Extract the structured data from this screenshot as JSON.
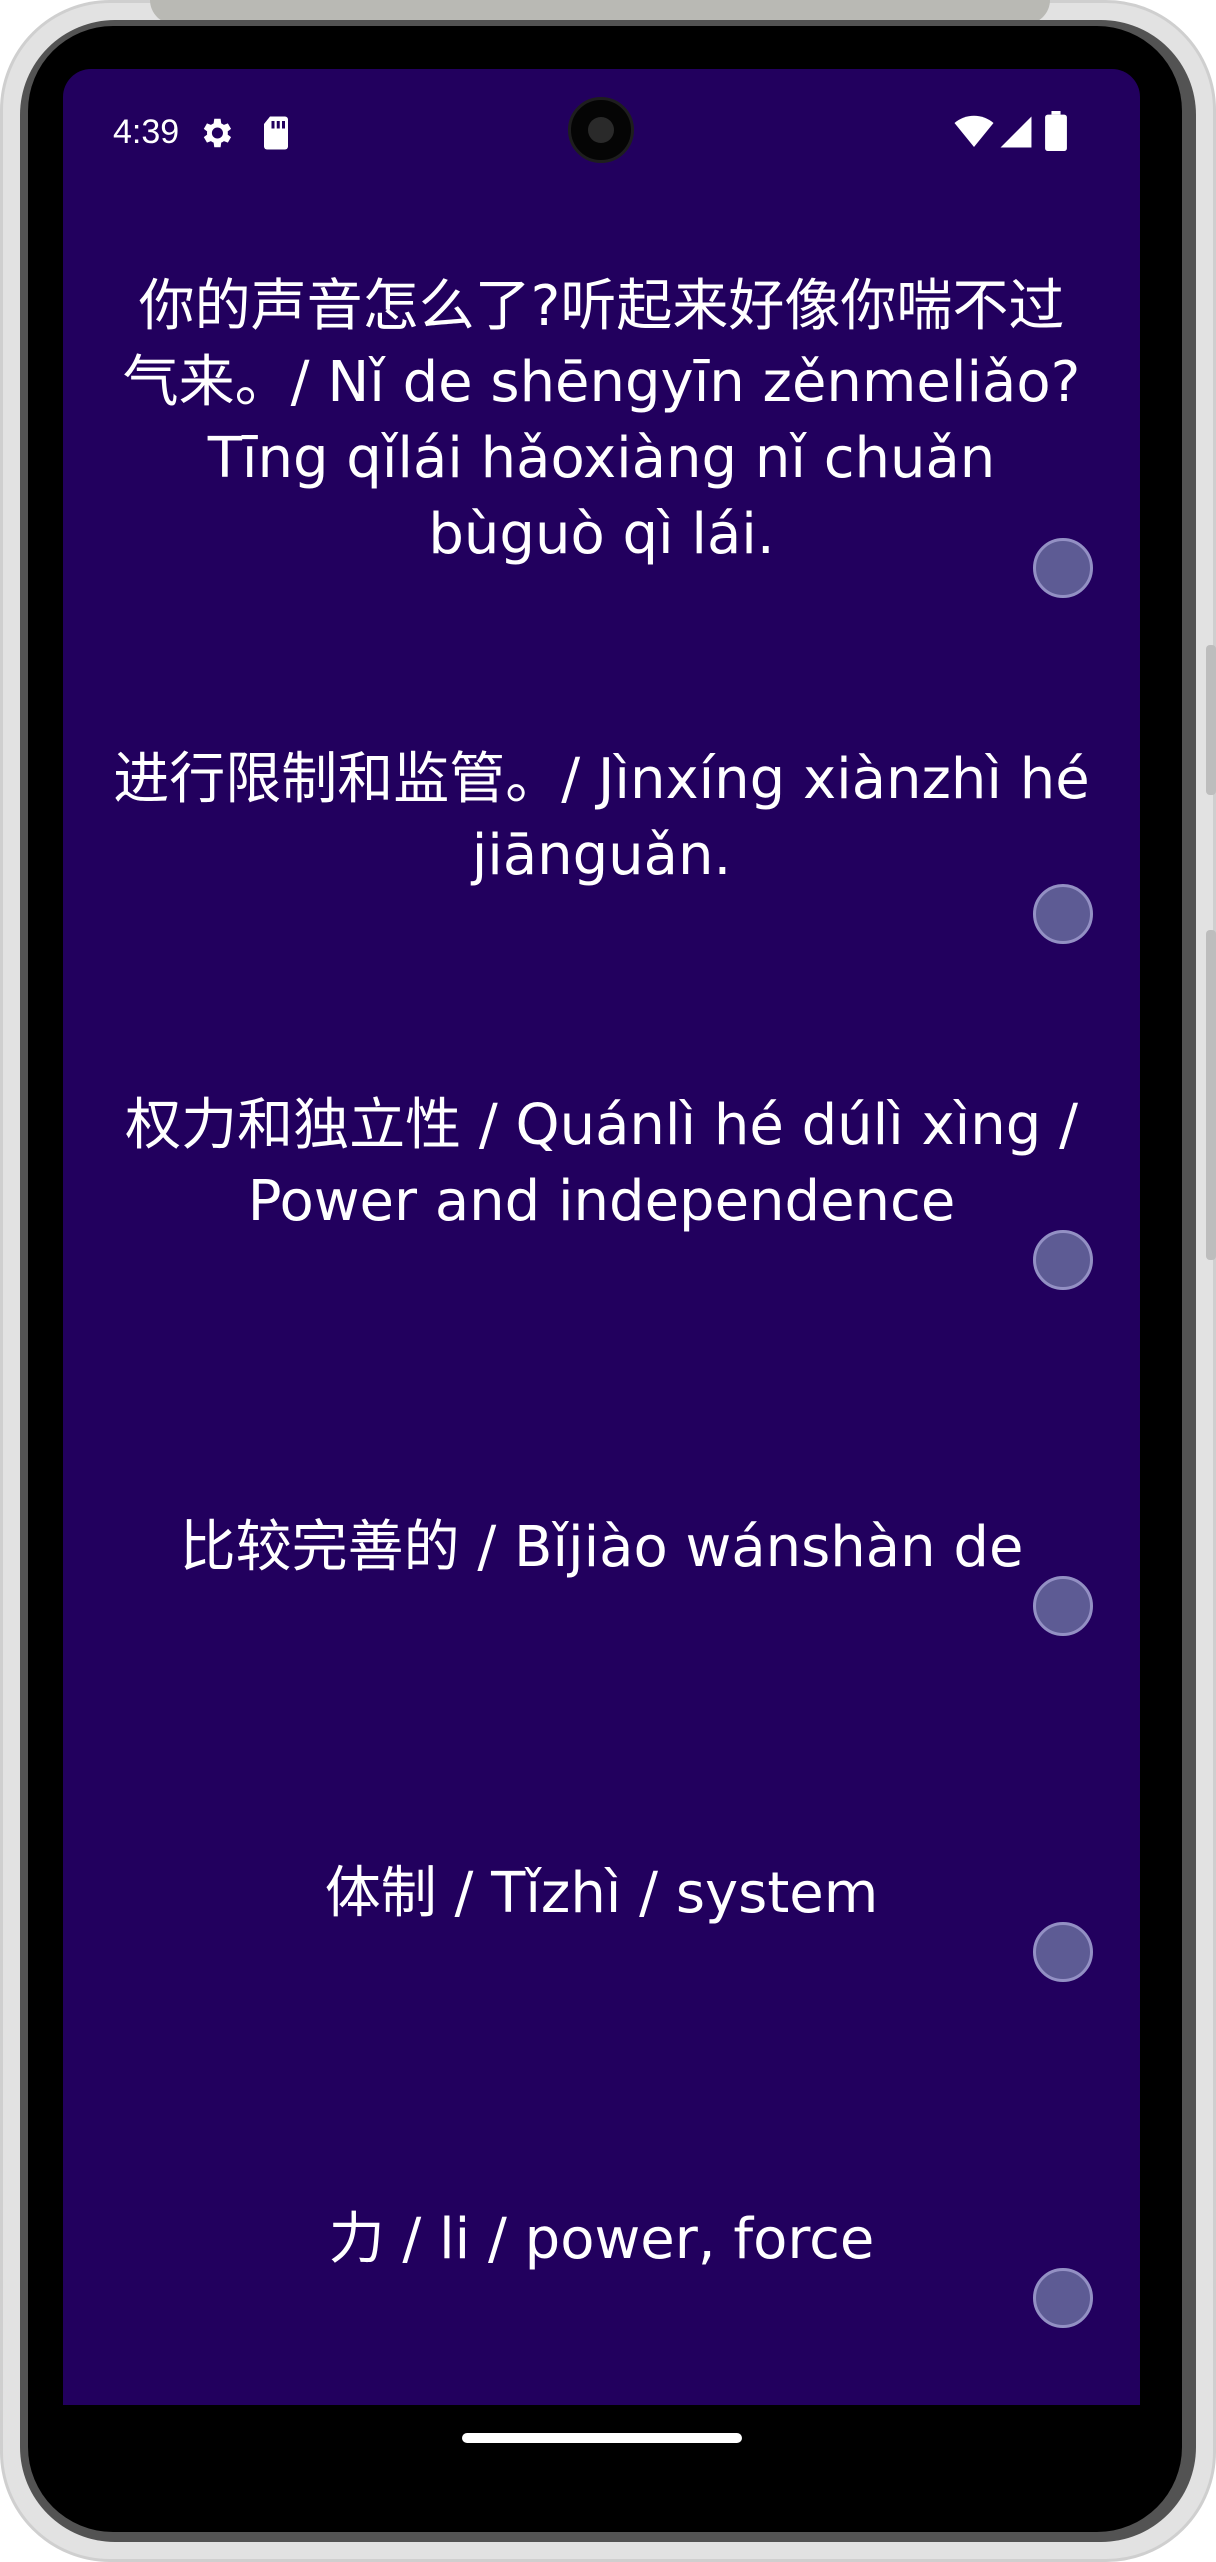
{
  "status_bar": {
    "time": "4:39",
    "left_icons": [
      "settings-gear-icon",
      "sd-card-icon"
    ],
    "right_icons": [
      "wifi-icon",
      "cell-signal-icon",
      "battery-icon"
    ]
  },
  "colors": {
    "background": "#22005e",
    "text": "#ffffff",
    "dot_fill": "#5d5b94",
    "dot_border": "#9390c4"
  },
  "phrases": [
    {
      "text": "你的声音怎么了?听起来好像你喘不过气来。/ Nǐ de shēngyīn zěnmeliǎo? Tīng qǐlái hǎoxiàng nǐ chuǎn bùguò qì lái.",
      "play_icon": "circle-button-icon"
    },
    {
      "text": "进行限制和监管。/ Jìnxíng xiànzhì hé jiānguǎn.",
      "play_icon": "circle-button-icon"
    },
    {
      "text": "权力和独立性 / Quánlì hé dúlì xìng / Power and independence",
      "play_icon": "circle-button-icon"
    },
    {
      "text": "比较完善的 / Bǐjiào wánshàn de",
      "play_icon": "circle-button-icon"
    },
    {
      "text": "体制 / Tǐzhì / system",
      "play_icon": "circle-button-icon"
    },
    {
      "text": "力 / li / power, force",
      "play_icon": "circle-button-icon"
    }
  ]
}
